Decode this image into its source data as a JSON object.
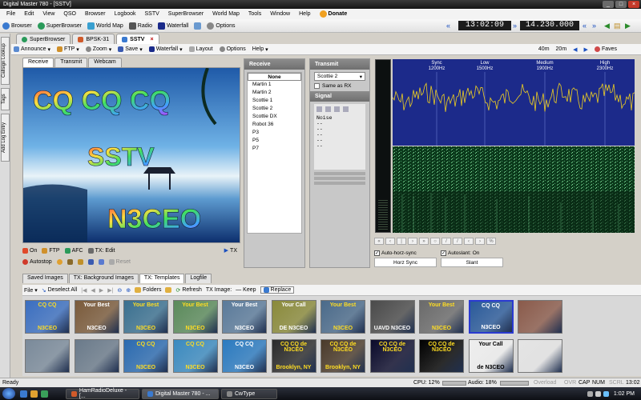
{
  "window": {
    "title": "Digital Master 780 - [SSTV]"
  },
  "menu": [
    "File",
    "Edit",
    "View",
    "QSO",
    "Browser",
    "Logbook",
    "SSTV",
    "SuperBrowser",
    "World Map",
    "Tools",
    "Window",
    "Help"
  ],
  "donate_label": "Donate",
  "toolbar": {
    "browser": "Browser",
    "superbrowser": "SuperBrowser",
    "worldmap": "World Map",
    "radio": "Radio",
    "waterfall": "Waterfall",
    "options": "Options"
  },
  "clock": "13:02:09",
  "frequency": "14.230.000",
  "tabs": [
    {
      "label": "SuperBrowser"
    },
    {
      "label": "BPSK-31"
    },
    {
      "label": "SSTV"
    }
  ],
  "sstv_toolbar": {
    "announce": "Announce",
    "ftp": "FTP",
    "zoom": "Zoom",
    "save": "Save",
    "waterfall": "Waterfall",
    "layout": "Layout",
    "options": "Options",
    "help": "Help",
    "band1": "40m",
    "band2": "20m",
    "faves": "Faves"
  },
  "side_tabs": [
    "Callsign Lookup",
    "Tags",
    "Add Log Entry"
  ],
  "image_tabs": [
    "Receive",
    "Transmit",
    "Webcam"
  ],
  "received_image": {
    "line1": "CQ CQ CQ",
    "line2": "SSTV",
    "line3": "N3CEO"
  },
  "image_controls": {
    "on": "On",
    "ftp": "FTP",
    "afc": "AFC",
    "tx_edit": "TX: Edit",
    "tx": "TX",
    "autostop": "Autostop",
    "reset": "Reset"
  },
  "receive_panel": {
    "header": "Receive",
    "modes": [
      "None",
      "Martin 1",
      "Martin 2",
      "Scottie 1",
      "Scottie 2",
      "Scottie DX",
      "Robot 36",
      "P3",
      "P5",
      "P7"
    ]
  },
  "transmit_panel": {
    "header": "Transmit",
    "mode": "Scottie 2",
    "same_as_rx": "Same as RX"
  },
  "signal_panel": {
    "header": "Signal",
    "noise": "Noise",
    "dashes": [
      "--",
      "--",
      "--",
      "--",
      "--"
    ]
  },
  "spectrum": {
    "labels": [
      {
        "name": "Sync",
        "freq": "1200Hz"
      },
      {
        "name": "Low",
        "freq": "1500Hz"
      },
      {
        "name": "Medium",
        "freq": "1900Hz"
      },
      {
        "name": "High",
        "freq": "2300Hz"
      }
    ]
  },
  "sync": {
    "auto_horz": "Auto-horz-sync",
    "auto_slant": "Autoslant: On",
    "horz_sync": "Horz Sync",
    "slant": "Slant"
  },
  "bottom_tabs": [
    "Saved Images",
    "TX: Background Images",
    "TX: Templates",
    "Logfile"
  ],
  "bottom_toolbar": {
    "file": "File",
    "deselect": "Deselect All",
    "folders": "Folders",
    "refresh": "Refresh",
    "tx_image": "TX Image:",
    "keep": "Keep",
    "replace": "Replace"
  },
  "thumbnails": [
    {
      "text": "CQ CQ",
      "sub": "N3CEO",
      "bg": "#3a6ec0",
      "fg": "#ffdd22"
    },
    {
      "text": "Your Best",
      "sub": "N3CEO",
      "bg": "#7a5a3a",
      "fg": "#ffffff"
    },
    {
      "text": "Your Best",
      "sub": "N3CEO",
      "bg": "#3a7090",
      "fg": "#ffdd22"
    },
    {
      "text": "Your Best",
      "sub": "N3CEO",
      "bg": "#5a8a5a",
      "fg": "#ffdd22"
    },
    {
      "text": "Your Best",
      "sub": "N3CEO",
      "bg": "#5a7a9a",
      "fg": "#ffffff"
    },
    {
      "text": "Your Call",
      "sub": "DE N3CEO",
      "bg": "#8a8a3a",
      "fg": "#ffffff"
    },
    {
      "text": "Your Best",
      "sub": "N3CEO",
      "bg": "#4a6a8a",
      "fg": "#ffdd22"
    },
    {
      "text": "",
      "sub": "UAVD   N3CEO",
      "bg": "#4a4a4a",
      "fg": "#ffffff"
    },
    {
      "text": "Your Best",
      "sub": "N3CEO",
      "bg": "#6a6a6a",
      "fg": "#ffdd22"
    },
    {
      "text": "CQ CQ",
      "sub": "N3CEO",
      "bg": "#2a5a9a",
      "fg": "#ffffff"
    },
    {
      "text": "",
      "sub": "",
      "bg": "#8a5a4a",
      "fg": "#ffffff"
    },
    {
      "text": "",
      "sub": "",
      "bg": "#7a8a9a",
      "fg": "#ffffff"
    },
    {
      "text": "",
      "sub": "",
      "bg": "#6a7a8a",
      "fg": "#ffffff"
    },
    {
      "text": "CQ CQ",
      "sub": "N3CEO",
      "bg": "#2a6ab0",
      "fg": "#ffdd22"
    },
    {
      "text": "CQ CQ",
      "sub": "N3CEO",
      "bg": "#3a8ac0",
      "fg": "#ffdd22"
    },
    {
      "text": "CQ CQ",
      "sub": "N3CEO",
      "bg": "#2a7ac0",
      "fg": "#ffffff"
    },
    {
      "text": "CQ CQ de N3CEO",
      "sub": "Brooklyn, NY",
      "bg": "#2a2a2a",
      "fg": "#ffdd22"
    },
    {
      "text": "CQ CQ de N3CEO",
      "sub": "Brooklyn, NY",
      "bg": "#4a3a2a",
      "fg": "#ffdd22"
    },
    {
      "text": "CQ CQ de N3CEO",
      "sub": "",
      "bg": "#0a0a2a",
      "fg": "#ffdd22"
    },
    {
      "text": "CQ CQ de N3CEO",
      "sub": "",
      "bg": "#000000",
      "fg": "#ffdd22"
    },
    {
      "text": "Your Call",
      "sub": "de N3CEO",
      "bg": "#eeeeee",
      "fg": "#000000"
    },
    {
      "text": "",
      "sub": "",
      "bg": "#e4e4e4",
      "fg": "#000000"
    }
  ],
  "status": {
    "ready": "Ready",
    "cpu": "CPU: 12%",
    "audio": "Audio: 18%",
    "overload": "Overload",
    "ovr": "OVR",
    "cap": "CAP",
    "num": "NUM",
    "scrl": "SCRL",
    "time": "13:02"
  },
  "taskbar": {
    "items": [
      "HamRadioDeluxe - [...",
      "Digital Master 780 - ...",
      "CwType"
    ],
    "time": "1:02 PM"
  }
}
